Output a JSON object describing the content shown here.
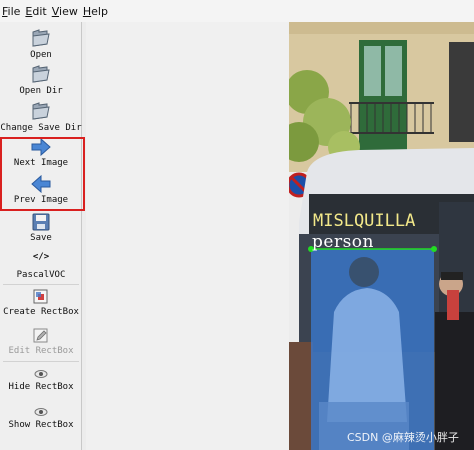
{
  "menu": {
    "file": "File",
    "edit": "Edit",
    "view": "View",
    "help": "Help"
  },
  "toolbar": {
    "open": "Open",
    "open_dir": "Open Dir",
    "change_save_dir": "Change Save Dir",
    "next_image": "Next Image",
    "prev_image": "Prev Image",
    "save": "Save",
    "format_icon_text": "</>",
    "format": "PascalVOC",
    "create_rectbox": "Create RectBox",
    "edit_rectbox": "Edit RectBox",
    "hide_rectbox": "Hide RectBox",
    "show_rectbox": "Show RectBox"
  },
  "image": {
    "bus_sign": "MISLQUILLA",
    "annotation_label": "person",
    "watermark": "CSDN @麻辣烫小胖子"
  },
  "colors": {
    "highlight_border": "#d9201f",
    "box_fill": "#3a7bd5",
    "box_vertex": "#22dd22"
  }
}
